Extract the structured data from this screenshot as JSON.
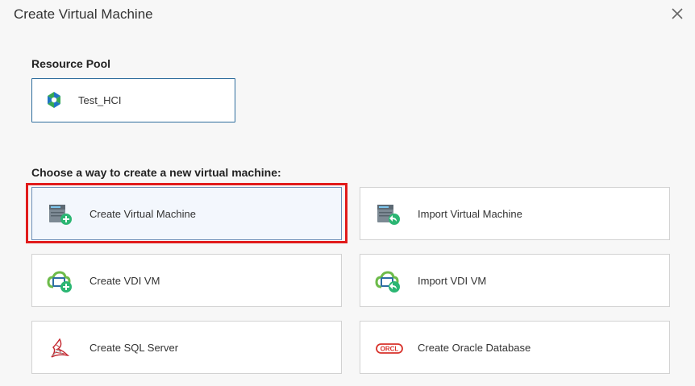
{
  "dialog": {
    "title": "Create Virtual Machine",
    "close_icon": "close-icon"
  },
  "resource_pool": {
    "heading": "Resource Pool",
    "selected": {
      "label": "Test_HCI",
      "icon": "hci-cluster-icon"
    }
  },
  "create_ways": {
    "heading": "Choose a way to create a new virtual machine:",
    "options": [
      {
        "label": "Create Virtual Machine",
        "icon": "server-add-icon",
        "selected": true
      },
      {
        "label": "Import Virtual Machine",
        "icon": "server-import-icon",
        "selected": false
      },
      {
        "label": "Create VDI VM",
        "icon": "vdi-add-icon",
        "selected": false
      },
      {
        "label": "Import VDI VM",
        "icon": "vdi-import-icon",
        "selected": false
      },
      {
        "label": "Create SQL Server",
        "icon": "sql-server-icon",
        "selected": false
      },
      {
        "label": "Create Oracle Database",
        "icon": "oracle-icon",
        "selected": false
      }
    ]
  },
  "colors": {
    "selection_highlight": "#e11b1b",
    "accent": "#2f6d9d",
    "add_badge": "#2bb673"
  }
}
